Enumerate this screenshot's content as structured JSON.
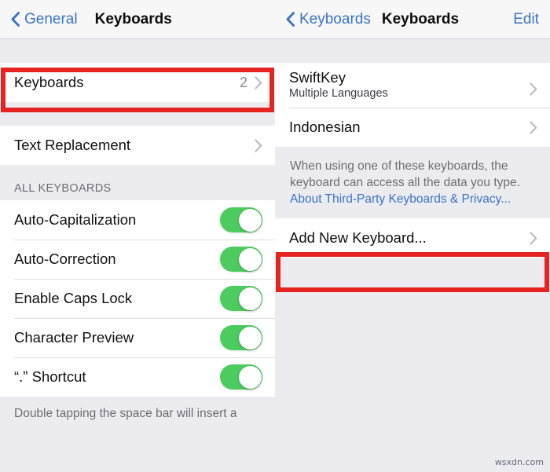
{
  "left_panel": {
    "navbar": {
      "back_label": "General",
      "title": "Keyboards",
      "back_icon": "chevron-left-icon"
    },
    "keyboards_group": [
      {
        "label": "Keyboards",
        "value": "2",
        "accessory": "chevron-right-icon",
        "highlighted": true
      }
    ],
    "text_replacement_group": [
      {
        "label": "Text Replacement",
        "value": "",
        "accessory": "chevron-right-icon"
      }
    ],
    "section_header": "ALL KEYBOARDS",
    "toggle_rows": [
      {
        "label": "Auto-Capitalization",
        "state": "on"
      },
      {
        "label": "Auto-Correction",
        "state": "on"
      },
      {
        "label": "Enable Caps Lock",
        "state": "on"
      },
      {
        "label": "Character Preview",
        "state": "on"
      },
      {
        "label": "“.” Shortcut",
        "state": "on"
      }
    ],
    "footer_note": "Double tapping the space bar will insert a"
  },
  "right_panel": {
    "navbar": {
      "back_label": "Keyboards",
      "title": "Keyboards",
      "edit_label": "Edit",
      "back_icon": "chevron-left-icon"
    },
    "keyboard_list": [
      {
        "name": "SwiftKey",
        "subtitle": "Multiple Languages",
        "accessory": "chevron-right-icon"
      },
      {
        "name": "Indonesian",
        "subtitle": "",
        "accessory": "chevron-right-icon"
      }
    ],
    "privacy_note": {
      "text": "When using one of these keyboards, the keyboard can access all the data you type. ",
      "link_text": "About Third-Party Keyboards & Privacy..."
    },
    "add_group": [
      {
        "label": "Add New Keyboard...",
        "accessory": "chevron-right-icon",
        "highlighted": true
      }
    ]
  },
  "watermark": "wsxdn.com",
  "colors": {
    "accent_blue": "#3b74c4",
    "toggle_green": "#4ccc5e",
    "highlight_red": "#e52421",
    "background": "#ebebf0",
    "row_background": "#ffffff",
    "secondary_text": "#6d6d72"
  }
}
